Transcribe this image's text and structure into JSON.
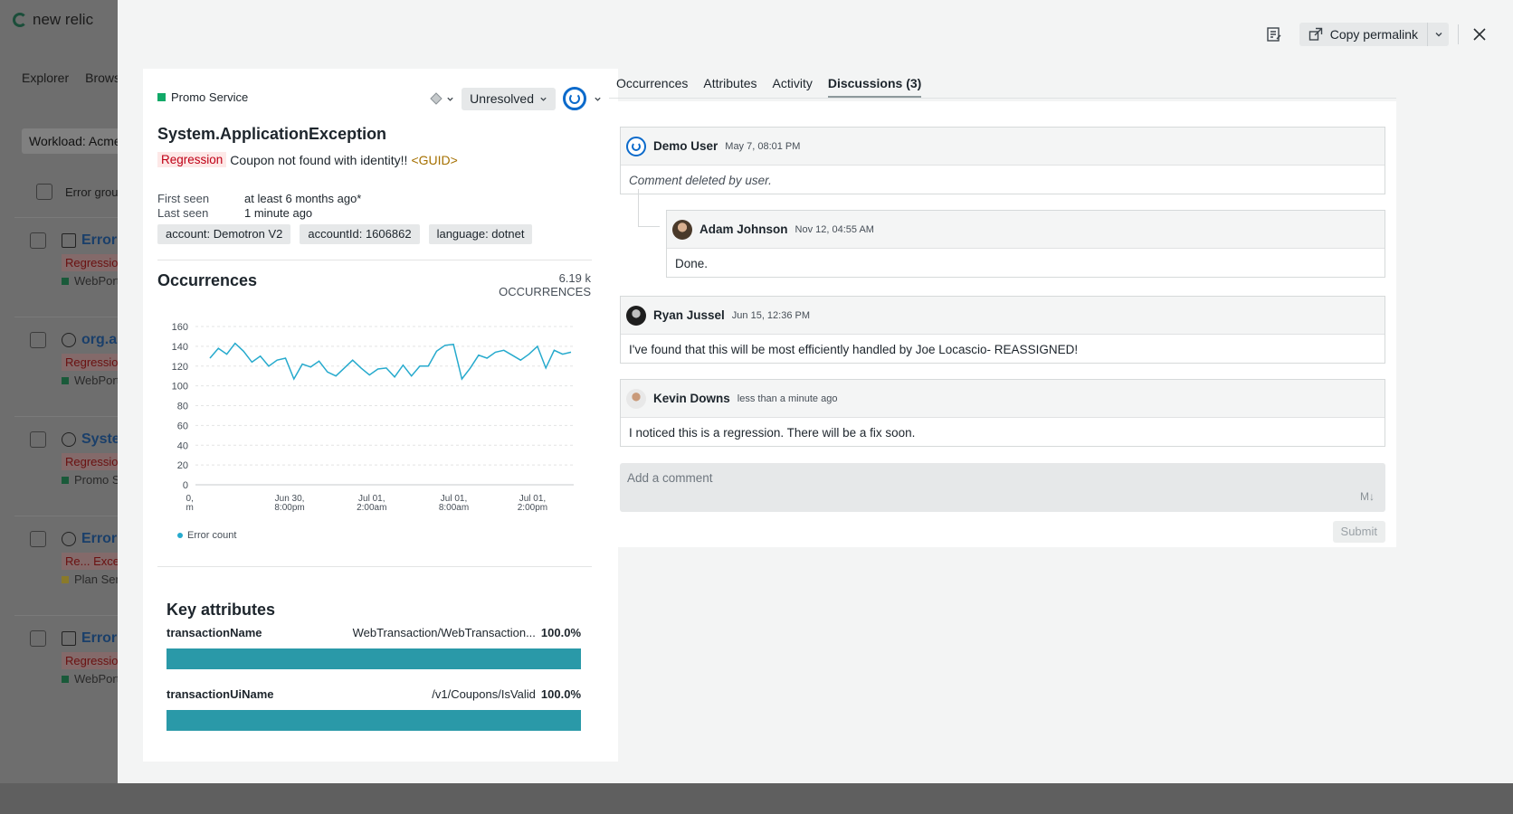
{
  "background": {
    "logo_text": "new relic",
    "nav": [
      "Explorer",
      "Browse"
    ],
    "workload": "Workload: Acme",
    "list_header": "Error group",
    "rows": [
      {
        "title": "Error",
        "tag": "Regression",
        "service": "WebPorta",
        "icon": "window-icon"
      },
      {
        "title": "org.ap",
        "tag": "Regression",
        "service": "WebPorta",
        "icon": "globe-icon"
      },
      {
        "title": "Systen",
        "tag": "Regression",
        "service": "Promo Se",
        "icon": "globe-icon"
      },
      {
        "title": "ErrorE",
        "tag": "Re... Excep",
        "service": "Plan Serv",
        "icon": "globe-icon"
      },
      {
        "title": "Error",
        "tag": "Regression",
        "service": "WebPorta",
        "icon": "window-icon"
      }
    ]
  },
  "toolbar": {
    "copy_permalink": "Copy permalink"
  },
  "error": {
    "entity": "Promo Service",
    "status": "Unresolved",
    "title": "System.ApplicationException",
    "tag": "Regression",
    "message": "Coupon not found with identity!!",
    "guid": "<GUID>",
    "first_seen_label": "First seen",
    "first_seen_value": "at least 6 months ago*",
    "last_seen_label": "Last seen",
    "last_seen_value": "1 minute ago",
    "chips": [
      "account: Demotron V2",
      "accountId: 1606862",
      "language: dotnet"
    ]
  },
  "occurrences": {
    "title": "Occurrences",
    "count": "6.19 k",
    "count_label": "OCCURRENCES",
    "legend": "Error count"
  },
  "chart_data": {
    "type": "line",
    "title": "Occurrences",
    "ylim": [
      0,
      160
    ],
    "yticks": [
      160,
      140,
      120,
      100,
      80,
      60,
      40,
      20,
      0
    ],
    "xticks": [
      {
        "l1": "0,",
        "l2": "m"
      },
      {
        "l1": "Jun 30,",
        "l2": "8:00pm"
      },
      {
        "l1": "Jul 01,",
        "l2": "2:00am"
      },
      {
        "l1": "Jul 01,",
        "l2": "8:00am"
      },
      {
        "l1": "Jul 01,",
        "l2": "2:00pm"
      }
    ],
    "series": [
      {
        "name": "Error count",
        "color": "#26aacd",
        "values": [
          128,
          138,
          132,
          143,
          135,
          124,
          130,
          120,
          126,
          128,
          107,
          122,
          119,
          125,
          114,
          110,
          118,
          126,
          118,
          111,
          117,
          118,
          109,
          121,
          110,
          120,
          120,
          135,
          141,
          142,
          107,
          118,
          131,
          128,
          134,
          136,
          131,
          126,
          132,
          140,
          118,
          136,
          132,
          134
        ]
      }
    ]
  },
  "key_attributes": {
    "title": "Key attributes",
    "rows": [
      {
        "name": "transactionName",
        "value": "WebTransaction/WebTransaction...",
        "pct": "100.0%",
        "fill": 1.0
      },
      {
        "name": "transactionUiName",
        "value": "/v1/Coupons/IsValid",
        "pct": "100.0%",
        "fill": 1.0
      }
    ]
  },
  "tabs": [
    "Occurrences",
    "Attributes",
    "Activity",
    "Discussions (3)"
  ],
  "comments": [
    {
      "author": "Demo User",
      "time": "May 7, 08:01 PM",
      "text": "Comment deleted by user."
    },
    {
      "author": "Adam Johnson",
      "time": "Nov 12, 04:55 AM",
      "text": "Done."
    },
    {
      "author": "Ryan Jussel",
      "time": "Jun 15, 12:36 PM",
      "text": "I've found that this will be most efficiently handled by Joe Locascio- REASSIGNED!"
    },
    {
      "author": "Kevin Downs",
      "time": "less than a minute ago",
      "text": "I noticed this is a regression. There will be a fix soon."
    }
  ],
  "composer": {
    "placeholder": "Add a comment",
    "markdown": "M↓",
    "submit": "Submit"
  }
}
